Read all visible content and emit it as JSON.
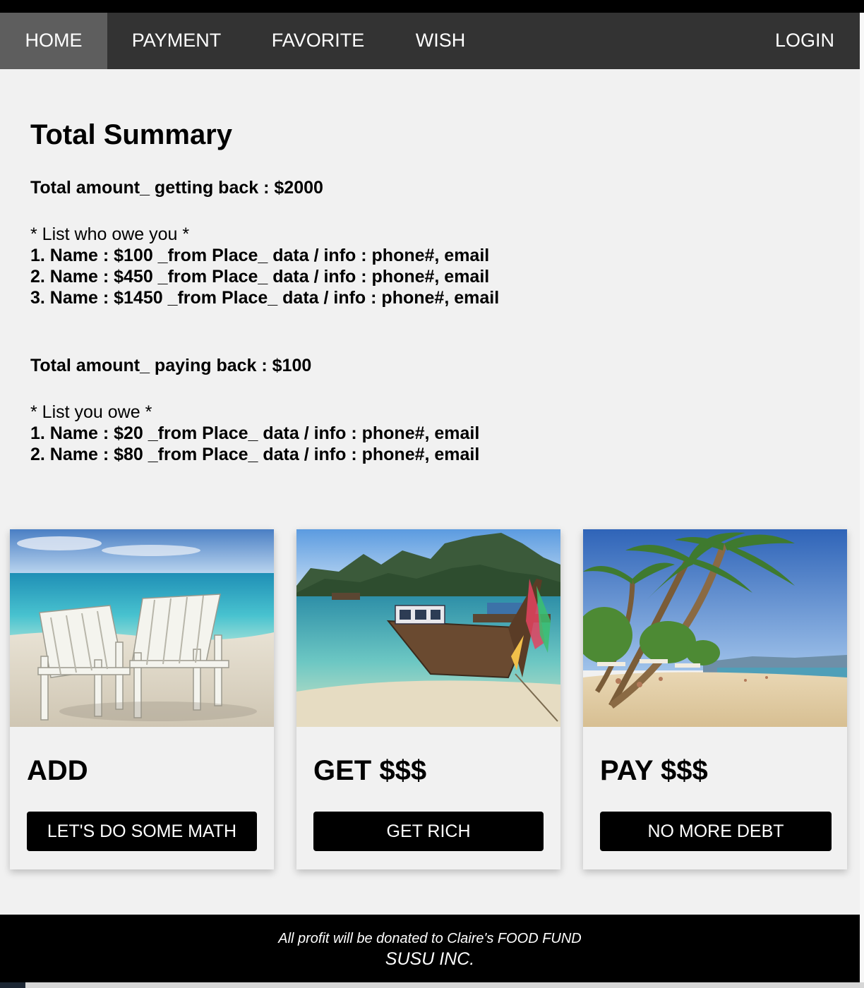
{
  "nav": {
    "home": "HOME",
    "payment": "PAYMENT",
    "favorite": "FAVORITE",
    "wish": "WISH",
    "login": "LOGIN"
  },
  "summary": {
    "title": "Total Summary",
    "getting_back_total": "Total amount_ getting back : $2000",
    "owe_you_title": "* List who owe you *",
    "owe_you": [
      "1. Name : $100 _from Place_ data / info : phone#, email",
      "2. Name : $450 _from Place_ data / info : phone#, email",
      "3. Name : $1450 _from Place_ data / info : phone#, email"
    ],
    "paying_back_total": "Total amount_ paying back : $100",
    "you_owe_title": "* List you owe *",
    "you_owe": [
      "1. Name : $20 _from Place_ data / info : phone#, email",
      "2. Name : $80 _from Place_ data / info : phone#, email"
    ]
  },
  "cards": [
    {
      "title": "ADD",
      "button": "LET'S DO SOME MATH",
      "image": "beach-chairs-photo"
    },
    {
      "title": "GET $$$",
      "button": "GET RICH",
      "image": "longtail-boat-photo"
    },
    {
      "title": "PAY $$$",
      "button": "NO MORE DEBT",
      "image": "palm-beach-photo"
    }
  ],
  "footer": {
    "line1": "All profit will be donated to Claire's FOOD FUND",
    "line2": "SUSU INC."
  },
  "colors": {
    "nav_bg": "#333333",
    "nav_active": "#5e5e5e",
    "page_bg": "#f1f1f1",
    "button_bg": "#000000",
    "footer_bg": "#000000"
  }
}
